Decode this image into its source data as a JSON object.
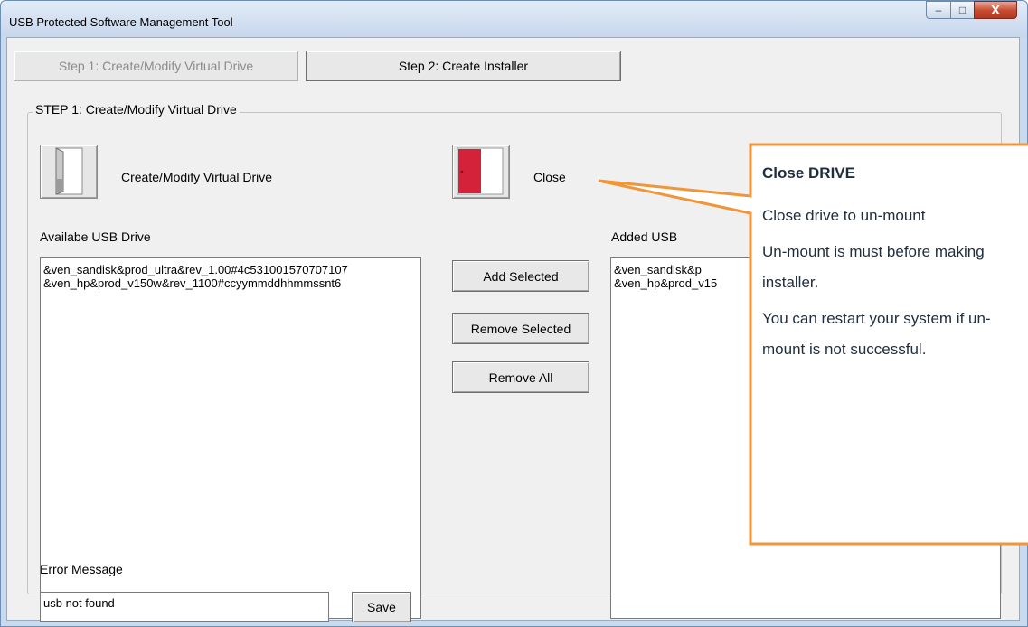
{
  "window": {
    "title": "USB Protected Software Management Tool",
    "min_glyph": "–",
    "max_glyph": "□",
    "close_glyph": "X"
  },
  "steps": {
    "step1_label": "Step 1: Create/Modify Virtual Drive",
    "step2_label": "Step 2: Create Installer"
  },
  "group": {
    "label": "STEP 1: Create/Modify Virtual Drive"
  },
  "drive": {
    "create_label": "Create/Modify Virtual Drive",
    "close_label": "Close"
  },
  "available": {
    "label": "Availabe USB Drive",
    "items": [
      "&ven_sandisk&prod_ultra&rev_1.00#4c531001570707107",
      "&ven_hp&prod_v150w&rev_1100#ccyymmddhhmmssnt6"
    ]
  },
  "actions": {
    "add": "Add Selected",
    "remove": "Remove Selected",
    "remove_all": "Remove All"
  },
  "added": {
    "label": "Added USB",
    "items": [
      "&ven_sandisk&p",
      "&ven_hp&prod_v15"
    ]
  },
  "error": {
    "label": "Error Message",
    "value": "usb not found",
    "save": "Save"
  },
  "callout": {
    "title": "Close DRIVE",
    "p1": "Close drive to un-mount",
    "p2": "Un-mount is must before making installer.",
    "p3": "You can restart your system if un-mount is not successful."
  },
  "colors": {
    "callout_border": "#f0953a",
    "door_red": "#d3223a"
  }
}
